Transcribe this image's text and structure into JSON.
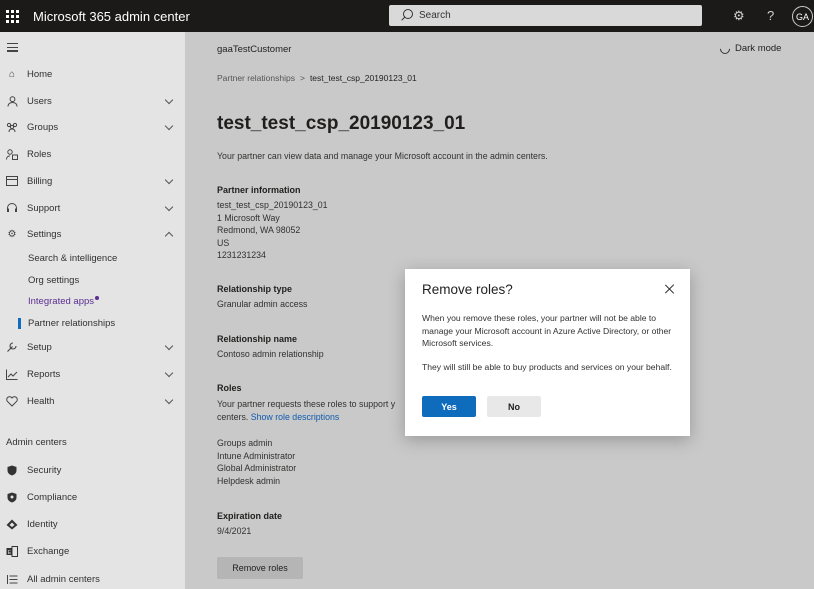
{
  "app": {
    "title": "Microsoft 365 admin center",
    "avatar_initials": "GA"
  },
  "search": {
    "placeholder": "Search"
  },
  "sidebar": {
    "items": [
      {
        "label": "Home",
        "icon": "home-icon"
      },
      {
        "label": "Users",
        "icon": "user-icon",
        "expandable": true
      },
      {
        "label": "Groups",
        "icon": "groups-icon",
        "expandable": true
      },
      {
        "label": "Roles",
        "icon": "roles-icon"
      },
      {
        "label": "Billing",
        "icon": "billing-icon",
        "expandable": true
      },
      {
        "label": "Support",
        "icon": "headset-icon",
        "expandable": true
      },
      {
        "label": "Settings",
        "icon": "gear-icon",
        "expanded": true
      }
    ],
    "settings_children": [
      "Search & intelligence",
      "Org settings",
      "Integrated apps",
      "Partner relationships"
    ],
    "items_after": [
      {
        "label": "Setup",
        "icon": "wrench-icon"
      },
      {
        "label": "Reports",
        "icon": "chart-icon"
      },
      {
        "label": "Health",
        "icon": "heart-icon"
      }
    ],
    "admin_centers_label": "Admin centers",
    "admin_centers": [
      "Security",
      "Compliance",
      "Identity",
      "Exchange",
      "All admin centers"
    ]
  },
  "header": {
    "tenant": "gaaTestCustomer",
    "dark_mode": "Dark mode"
  },
  "breadcrumb": {
    "parent": "Partner relationships",
    "current": "test_test_csp_20190123_01"
  },
  "page": {
    "title": "test_test_csp_20190123_01",
    "description": "Your partner can view data and manage your Microsoft account in the admin centers.",
    "partner_info_label": "Partner information",
    "partner_info_lines": [
      "test_test_csp_20190123_01",
      "1 Microsoft Way",
      "Redmond, WA 98052",
      "US",
      "1231231234"
    ],
    "relationship_type_label": "Relationship type",
    "relationship_type": "Granular admin access",
    "relationship_name_label": "Relationship name",
    "relationship_name": "Contoso admin relationship",
    "roles_label": "Roles",
    "roles_text_1": "Your partner requests these roles to support y",
    "roles_text_2": "centers.",
    "roles_link": "Show role descriptions",
    "roles": [
      "Groups admin",
      "Intune Administrator",
      "Global Administrator",
      "Helpdesk admin"
    ],
    "expiration_label": "Expiration date",
    "expiration": "9/4/2021",
    "remove_button": "Remove roles"
  },
  "dialog": {
    "title": "Remove roles?",
    "p1": "When you remove these roles, your partner will not be able to manage your Microsoft account in Azure Active Directory, or other Microsoft services.",
    "p2": "They will still be able to buy products and services on your behalf.",
    "yes": "Yes",
    "no": "No"
  },
  "colors": {
    "accent": "#0f6cbd",
    "topbar": "#1b1a19",
    "link": "#0f5cae",
    "indicator": "#5c2e91"
  }
}
